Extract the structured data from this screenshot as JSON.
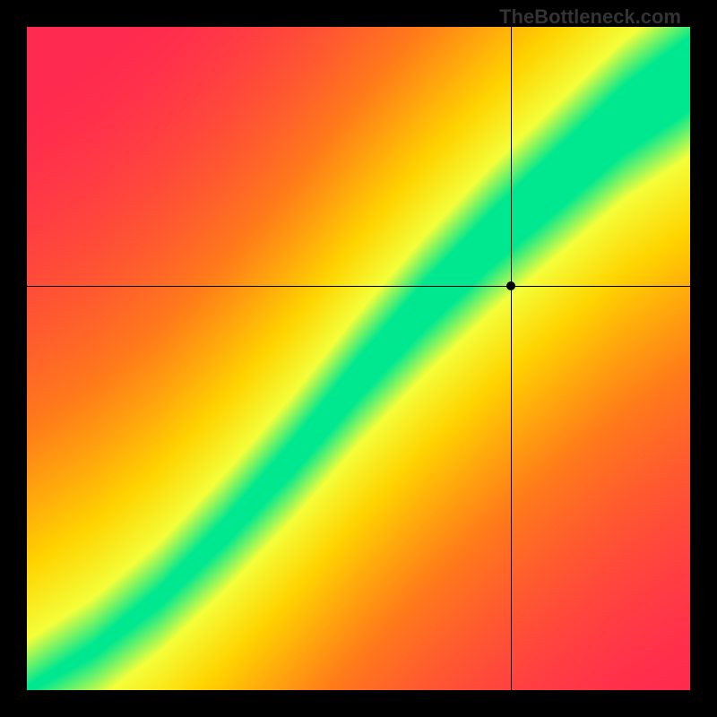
{
  "watermark": "TheBottleneck.com",
  "chart_data": {
    "type": "heatmap",
    "title": "",
    "xlabel": "",
    "ylabel": "",
    "xlim": [
      0,
      1
    ],
    "ylim": [
      0,
      1
    ],
    "marker": {
      "x": 0.73,
      "y": 0.61
    },
    "crosshair": {
      "x": 0.73,
      "y": 0.61
    },
    "optimal_band": {
      "description": "Green diagonal band indicating balanced CPU/GPU pairing; S-shaped curve from origin to top-right",
      "center_curve_points": [
        {
          "x": 0.0,
          "y": 0.0
        },
        {
          "x": 0.1,
          "y": 0.06
        },
        {
          "x": 0.2,
          "y": 0.14
        },
        {
          "x": 0.3,
          "y": 0.24
        },
        {
          "x": 0.4,
          "y": 0.35
        },
        {
          "x": 0.5,
          "y": 0.47
        },
        {
          "x": 0.6,
          "y": 0.58
        },
        {
          "x": 0.7,
          "y": 0.68
        },
        {
          "x": 0.8,
          "y": 0.77
        },
        {
          "x": 0.9,
          "y": 0.86
        },
        {
          "x": 1.0,
          "y": 0.93
        }
      ],
      "band_halfwidth_start": 0.01,
      "band_halfwidth_end": 0.1
    },
    "color_scale": [
      {
        "stop": 0.0,
        "color": "#ff2a4f"
      },
      {
        "stop": 0.4,
        "color": "#ff7a1a"
      },
      {
        "stop": 0.7,
        "color": "#ffd400"
      },
      {
        "stop": 0.88,
        "color": "#f4ff3a"
      },
      {
        "stop": 1.0,
        "color": "#00e88f"
      }
    ]
  }
}
